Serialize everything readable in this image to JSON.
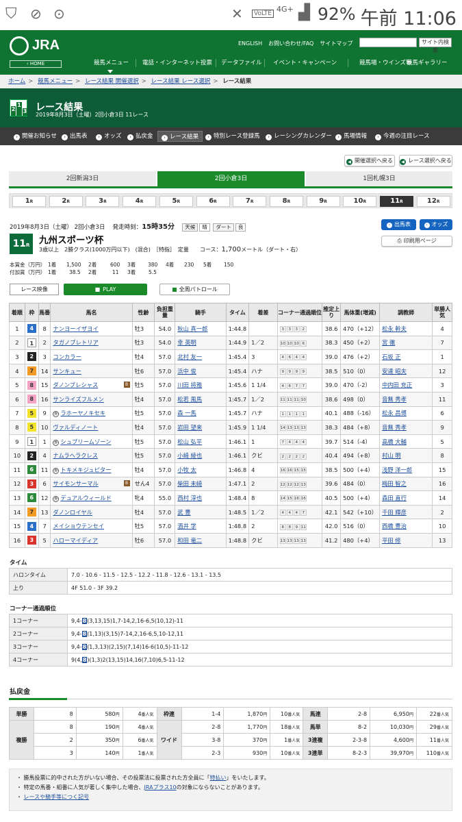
{
  "status": {
    "battery": "92%",
    "time": "午前 11:06",
    "network": "4G+",
    "volte": "VoLTE"
  },
  "header": {
    "logo": "JRA",
    "home": "‹ HOME",
    "links": [
      "ENGLISH",
      "お問い合わせ/FAQ",
      "サイトマップ"
    ],
    "search_button": "サイト内検索",
    "nav": [
      "競馬メニュー",
      "電話・インターネット投票",
      "データファイル",
      "イベント・キャンペーン",
      "競馬場・ウインズ等",
      "競馬ギャラリー"
    ]
  },
  "breadcrumb": [
    "ホーム",
    "競馬メニュー",
    "レース結果 開催選択",
    "レース結果 レース選択",
    "レース結果"
  ],
  "title": {
    "main": "レース結果",
    "sub": "2019年8月3日（土曜）2回小倉3日 11レース"
  },
  "subnav": [
    "開催お知らせ",
    "出馬表",
    "オッズ",
    "払戻金",
    "レース結果",
    "特別レース登録馬",
    "レーシングカレンダー",
    "馬場情報",
    "今週の注目レース"
  ],
  "back_buttons": [
    "開催選択へ戻る",
    "レース選択へ戻る"
  ],
  "venues": [
    "2回新潟3日",
    "2回小倉3日",
    "1回札幌3日"
  ],
  "races": [
    "1",
    "2",
    "3",
    "4",
    "5",
    "6",
    "7",
    "8",
    "9",
    "10",
    "11",
    "12"
  ],
  "race_suffix": "R",
  "race": {
    "date_line": "2019年8月3日（土曜） 2回小倉3日",
    "start_label": "発走時刻：",
    "start_time": "15時35分",
    "weather_label": "天候",
    "weather": "晴",
    "track_label": "ダート",
    "track": "良",
    "num": "11",
    "name": "九州スポーツ杯",
    "cond1": "3歳以上　2勝クラス(1000万円以下)　(混合)　［特指］　定量",
    "course_label": "コース：",
    "course_dist": "1,700",
    "course_unit": "メートル（ダート・右）",
    "btn_shutuba": "出馬表",
    "btn_odds": "オッズ",
    "btn_print": "印刷用ページ"
  },
  "prize": {
    "row1": [
      "本賞金（万円）",
      "1着",
      "1,500",
      "2着",
      "600",
      "3着",
      "380",
      "4着",
      "230",
      "5着",
      "150"
    ],
    "row2": [
      "付加賞（万円）",
      "1着",
      "38.5",
      "2着",
      "11",
      "3着",
      "5.5"
    ]
  },
  "video": {
    "label": "レース映像",
    "play": "PLAY",
    "patrol": "全周パトロール"
  },
  "table_headers": [
    "着順",
    "枠",
    "馬番",
    "馬名",
    "性齢",
    "負担重量",
    "騎手",
    "タイム",
    "着差",
    "コーナー通過順位",
    "推定上り",
    "馬体重(増減)",
    "調教師",
    "単勝人気"
  ],
  "results": [
    {
      "pos": "1",
      "w": "4",
      "n": "8",
      "name": "ナンヨーイザヨイ",
      "mk": "",
      "b": "",
      "age": "牡3",
      "wt": "54.0",
      "jockey": "秋山 真一郎",
      "time": "1:44.8",
      "margin": "",
      "c": [
        "3",
        "3",
        "3",
        "2"
      ],
      "f3": "38.6",
      "bw": "470（+12）",
      "trainer": "松永 幹夫",
      "pop": "4"
    },
    {
      "pos": "2",
      "w": "1",
      "n": "2",
      "name": "タガノブレトリア",
      "mk": "",
      "b": "",
      "age": "牡3",
      "wt": "54.0",
      "jockey": "幸 英明",
      "time": "1:44.9",
      "margin": "1／2",
      "c": [
        "10",
        "10",
        "10",
        "6"
      ],
      "f3": "38.3",
      "bw": "450（+2）",
      "trainer": "宮 徹",
      "pop": "7"
    },
    {
      "pos": "3",
      "w": "2",
      "n": "3",
      "name": "コンカラー",
      "mk": "",
      "b": "",
      "age": "牡4",
      "wt": "57.0",
      "jockey": "北村 友一",
      "time": "1:45.4",
      "margin": "3",
      "c": [
        "4",
        "6",
        "4",
        "4"
      ],
      "f3": "39.0",
      "bw": "476（+2）",
      "trainer": "石坂 正",
      "pop": "1"
    },
    {
      "pos": "4",
      "w": "7",
      "n": "14",
      "name": "サンキュー",
      "mk": "",
      "b": "",
      "age": "牡6",
      "wt": "57.0",
      "jockey": "浜中 俊",
      "time": "1:45.4",
      "margin": "ハナ",
      "c": [
        "9",
        "9",
        "9",
        "9"
      ],
      "f3": "38.5",
      "bw": "510（0）",
      "trainer": "安達 昭夫",
      "pop": "12"
    },
    {
      "pos": "5",
      "w": "8",
      "n": "15",
      "name": "ダノンブレシャス",
      "mk": "",
      "b": "B",
      "age": "牡5",
      "wt": "57.0",
      "jockey": "川田 将雅",
      "time": "1:45.6",
      "margin": "1 1/4",
      "c": [
        "4",
        "6",
        "7",
        "7"
      ],
      "f3": "39.0",
      "bw": "470（-2）",
      "trainer": "中内田 充正",
      "pop": "3"
    },
    {
      "pos": "6",
      "w": "8",
      "n": "16",
      "name": "サンライズフルメン",
      "mk": "",
      "b": "",
      "age": "牡4",
      "wt": "57.0",
      "jockey": "松若 風馬",
      "time": "1:45.7",
      "margin": "1／2",
      "c": [
        "11",
        "11",
        "11",
        "10"
      ],
      "f3": "38.6",
      "bw": "498（0）",
      "trainer": "音無 秀孝",
      "pop": "11"
    },
    {
      "pos": "7",
      "w": "5",
      "n": "9",
      "name": "ラホーヤノキセキ",
      "mk": "外",
      "b": "",
      "age": "牡5",
      "wt": "57.0",
      "jockey": "森 一馬",
      "time": "1:45.7",
      "margin": "ハナ",
      "c": [
        "1",
        "1",
        "1",
        "1"
      ],
      "f3": "40.1",
      "bw": "488（-16）",
      "trainer": "松永 昌博",
      "pop": "6"
    },
    {
      "pos": "8",
      "w": "5",
      "n": "10",
      "name": "ヴァルディノート",
      "mk": "",
      "b": "",
      "age": "牡4",
      "wt": "57.0",
      "jockey": "岩田 望来",
      "time": "1:45.9",
      "margin": "1 1/4",
      "c": [
        "14",
        "13",
        "13",
        "13"
      ],
      "f3": "38.3",
      "bw": "484（+8）",
      "trainer": "音無 秀孝",
      "pop": "9"
    },
    {
      "pos": "9",
      "w": "1",
      "n": "1",
      "name": "シュプリームゾーン",
      "mk": "外",
      "b": "",
      "age": "牡5",
      "wt": "57.0",
      "jockey": "松山 弘平",
      "time": "1:46.1",
      "margin": "1",
      "c": [
        "7",
        "4",
        "4",
        "4"
      ],
      "f3": "39.7",
      "bw": "514（-4）",
      "trainer": "高橋 大輔",
      "pop": "5"
    },
    {
      "pos": "10",
      "w": "2",
      "n": "4",
      "name": "ナムラヘラクレス",
      "mk": "",
      "b": "",
      "age": "牡5",
      "wt": "57.0",
      "jockey": "小崎 綾也",
      "time": "1:46.1",
      "margin": "クビ",
      "c": [
        "2",
        "2",
        "2",
        "2"
      ],
      "f3": "40.4",
      "bw": "494（+8）",
      "trainer": "村山 明",
      "pop": "8"
    },
    {
      "pos": "11",
      "w": "6",
      "n": "11",
      "name": "トキメキジュピター",
      "mk": "外",
      "b": "",
      "age": "牡4",
      "wt": "57.0",
      "jockey": "小牧 太",
      "time": "1:46.8",
      "margin": "4",
      "c": [
        "16",
        "16",
        "15",
        "15"
      ],
      "f3": "38.5",
      "bw": "500（+4）",
      "trainer": "浅野 洋一郎",
      "pop": "15"
    },
    {
      "pos": "12",
      "w": "3",
      "n": "6",
      "name": "サイモンサーマル",
      "mk": "",
      "b": "B",
      "age": "せん4",
      "wt": "57.0",
      "jockey": "柴田 未崎",
      "time": "1:47.1",
      "margin": "2",
      "c": [
        "12",
        "12",
        "12",
        "13"
      ],
      "f3": "39.6",
      "bw": "484（0）",
      "trainer": "梅田 智之",
      "pop": "16"
    },
    {
      "pos": "13",
      "w": "6",
      "n": "12",
      "name": "デュアルウィールド",
      "mk": "外",
      "b": "",
      "age": "牝4",
      "wt": "55.0",
      "jockey": "西村 淳也",
      "time": "1:48.4",
      "margin": "8",
      "c": [
        "14",
        "15",
        "16",
        "16"
      ],
      "f3": "40.5",
      "bw": "500（+4）",
      "trainer": "森田 直行",
      "pop": "14"
    },
    {
      "pos": "14",
      "w": "7",
      "n": "13",
      "name": "ダノンロイヤル",
      "mk": "",
      "b": "",
      "age": "牡4",
      "wt": "57.0",
      "jockey": "武 豊",
      "time": "1:48.5",
      "margin": "1／2",
      "c": [
        "4",
        "4",
        "4",
        "7"
      ],
      "f3": "42.1",
      "bw": "542（+10）",
      "trainer": "千田 輝彦",
      "pop": "2"
    },
    {
      "pos": "15",
      "w": "4",
      "n": "7",
      "name": "メイショウテンセイ",
      "mk": "",
      "b": "",
      "age": "牡5",
      "wt": "57.0",
      "jockey": "酒井 学",
      "time": "1:48.8",
      "margin": "2",
      "c": [
        "8",
        "8",
        "9",
        "11"
      ],
      "f3": "42.0",
      "bw": "516（0）",
      "trainer": "西橋 豊治",
      "pop": "10"
    },
    {
      "pos": "16",
      "w": "3",
      "n": "5",
      "name": "ハローマイディア",
      "mk": "",
      "b": "",
      "age": "牡6",
      "wt": "57.0",
      "jockey": "和田 竜二",
      "time": "1:48.8",
      "margin": "クビ",
      "c": [
        "13",
        "13",
        "13",
        "13"
      ],
      "f3": "41.2",
      "bw": "480（+4）",
      "trainer": "平田 修",
      "pop": "13"
    }
  ],
  "time_section": {
    "heading": "タイム",
    "rows": [
      {
        "label": "ハロンタイム",
        "value": "7.0 - 10.6 - 11.5 - 12.5 - 12.2 - 11.8 - 12.6 - 13.1 - 13.5"
      },
      {
        "label": "上り",
        "value": "4F 51.0 - 3F 39.2"
      }
    ]
  },
  "corner_section": {
    "heading": "コーナー通過順位",
    "rows": [
      {
        "label": "1コーナー",
        "pre": "9,4-",
        "hl": "8",
        "post": "(3,13,15)1,7-14,2,16-6,5(10,12)-11"
      },
      {
        "label": "2コーナー",
        "pre": "9,4-",
        "hl": "8",
        "post": "(1,13)(3,15)7-14,2,16-6,5,10-12,11"
      },
      {
        "label": "3コーナー",
        "pre": "9,4-",
        "hl": "8",
        "post": "(1,3,13)(2,15)(7,14)16-6(10,5)-11-12"
      },
      {
        "label": "4コーナー",
        "pre": "9(4,",
        "hl": "8",
        "post": ")(1,3)2(13,15)14,16(7,10)6,5-11-12"
      }
    ]
  },
  "payout": {
    "heading": "払戻金",
    "pop_unit": "番人気",
    "yen": "円",
    "win": {
      "label": "単勝",
      "rows": [
        [
          "8",
          "580",
          "4"
        ]
      ]
    },
    "place": {
      "label": "複勝",
      "rows": [
        [
          "8",
          "190",
          "4"
        ],
        [
          "2",
          "350",
          "6"
        ],
        [
          "3",
          "140",
          "1"
        ]
      ]
    },
    "wakuren": {
      "label": "枠連",
      "rows": [
        [
          "1-4",
          "1,870",
          "10"
        ]
      ]
    },
    "wide": {
      "label": "ワイド",
      "rows": [
        [
          "2-8",
          "1,770",
          "18"
        ],
        [
          "3-8",
          "370",
          "1"
        ],
        [
          "2-3",
          "930",
          "10"
        ]
      ]
    },
    "umaren": {
      "label": "馬連",
      "rows": [
        [
          "2-8",
          "6,950",
          "22"
        ]
      ]
    },
    "umatan": {
      "label": "馬単",
      "rows": [
        [
          "8-2",
          "10,030",
          "29"
        ]
      ]
    },
    "trio": {
      "label": "3連複",
      "rows": [
        [
          "2-3-8",
          "4,600",
          "11"
        ]
      ]
    },
    "trifecta": {
      "label": "3連単",
      "rows": [
        [
          "8-2-3",
          "39,970",
          "110"
        ]
      ]
    }
  },
  "notes": {
    "n1_pre": "勝馬投票に的中された方がいない場合、その投票法に投票された方全員に「",
    "n1_link": "特払い",
    "n1_post": "」をいたします。",
    "n2_pre": "特定の馬番・組番に人気が著しく集中した場合、",
    "n2_link": "JRAプラス10",
    "n2_post": "の対象にならないことがあります。",
    "n3_link": "レースや騎手等につく記号"
  },
  "colors": {
    "green": "#0f7431",
    "dark_green": "#0d5c37",
    "tab_green": "#1a8a2b",
    "blue": "#1565c0"
  }
}
